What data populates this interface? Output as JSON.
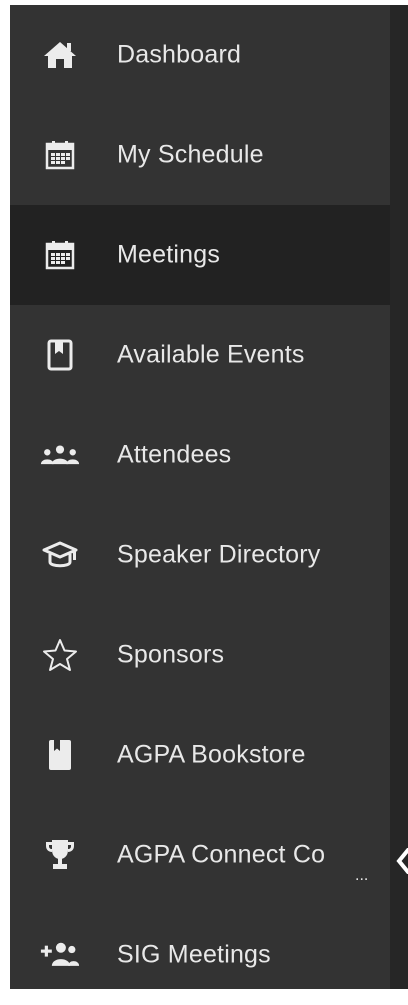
{
  "sidebar": {
    "items": [
      {
        "label": "Dashboard",
        "icon": "home-icon",
        "active": false
      },
      {
        "label": "My Schedule",
        "icon": "calendar-icon",
        "active": false
      },
      {
        "label": "Meetings",
        "icon": "calendar-icon",
        "active": true
      },
      {
        "label": "Available Events",
        "icon": "bookmark-icon",
        "active": false
      },
      {
        "label": "Attendees",
        "icon": "users-icon",
        "active": false
      },
      {
        "label": "Speaker Directory",
        "icon": "graduation-cap-icon",
        "active": false
      },
      {
        "label": "Sponsors",
        "icon": "star-outline-icon",
        "active": false
      },
      {
        "label": "AGPA Bookstore",
        "icon": "book-icon",
        "active": false
      },
      {
        "label": "AGPA Connect Co",
        "icon": "trophy-icon",
        "active": false
      },
      {
        "label": "SIG Meetings",
        "icon": "user-add-icon",
        "active": false
      }
    ],
    "truncation": "..."
  },
  "colors": {
    "sidebar_bg": "#333333",
    "active_bg": "#222222",
    "outer_bg": "#262626",
    "text": "#e8e8e8"
  }
}
